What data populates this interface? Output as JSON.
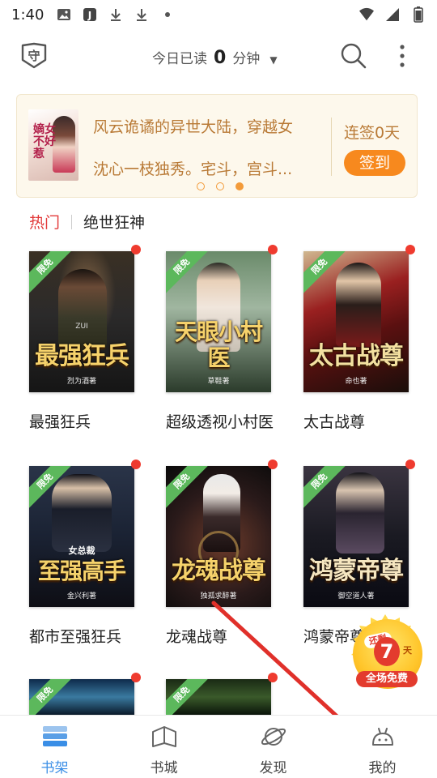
{
  "status_bar": {
    "time": "1:40",
    "left_icons": [
      "image-icon",
      "j-app-icon",
      "download-icon",
      "download-icon",
      "dot-icon"
    ],
    "right_icons": [
      "wifi-icon",
      "signal-icon",
      "battery-icon"
    ]
  },
  "header": {
    "shield_icon": "shield-icon",
    "reading_prefix": "今日已读",
    "reading_minutes": "0",
    "reading_unit": "分钟",
    "dropdown_icon": "triangle-down-icon",
    "search_icon": "search-icon",
    "more_icon": "more-vertical-icon"
  },
  "banner": {
    "cover_text": "嫡女不好惹",
    "line1": "风云诡谲的异世大陆，穿越女",
    "line2": "沈心一枝独秀。宅斗，宫斗...",
    "signin_days": "连签0天",
    "signin_button": "签到",
    "pager_count": 3,
    "pager_active": 2
  },
  "category": {
    "hot": "热门",
    "title": "绝世狂神"
  },
  "badge_label": "限免",
  "books": [
    {
      "title": "最强狂兵",
      "cover_title": "最强狂兵",
      "cover_author": "烈为酒著",
      "cover_zui": "ZUI",
      "colors": [
        "#2b2a2a",
        "#574a3a",
        "#151515"
      ]
    },
    {
      "title": "超级透视小村医",
      "cover_title": "天眼小村医",
      "cover_author": "草鞋著",
      "colors": [
        "#4a6a4a",
        "#a0b6a0",
        "#2b3b2b"
      ]
    },
    {
      "title": "太古战尊",
      "cover_title": "太古战尊",
      "cover_author": "命也著",
      "colors": [
        "#7a1a1a",
        "#c9a37a",
        "#2a1a14"
      ]
    },
    {
      "title": "都市至强狂兵",
      "cover_title": "至强高手",
      "cover_subtitle": "女总裁",
      "cover_author": "金兴利著",
      "colors": [
        "#1a2233",
        "#4a5a7a",
        "#0e0e14"
      ]
    },
    {
      "title": "龙魂战尊",
      "cover_title": "龙魂战尊",
      "cover_author": "独孤求醉著",
      "colors": [
        "#2a1a1a",
        "#6a3a2a",
        "#0a0a0a"
      ]
    },
    {
      "title": "鸿蒙帝尊",
      "cover_title": "鸿蒙帝尊",
      "cover_author": "御空道人著",
      "colors": [
        "#1a1a22",
        "#4a4050",
        "#0a0a12"
      ]
    },
    {
      "title": "",
      "colors": [
        "#0e2a4a",
        "#3a7aa0",
        "#0a1a2a"
      ]
    },
    {
      "title": "",
      "colors": [
        "#1a2a14",
        "#3a5a2a",
        "#0a140a"
      ]
    }
  ],
  "float_badge": {
    "top": "还剩",
    "number": "7",
    "unit": "天",
    "bottom": "全场免费"
  },
  "bottom_nav": [
    {
      "label": "书架",
      "icon": "bookshelf-icon",
      "active": true
    },
    {
      "label": "书城",
      "icon": "book-open-icon",
      "active": false
    },
    {
      "label": "发现",
      "icon": "planet-icon",
      "active": false
    },
    {
      "label": "我的",
      "icon": "mascot-icon",
      "active": false
    }
  ],
  "colors": {
    "accent_orange": "#f7891e",
    "hot_red": "#e23a3a",
    "nav_active": "#3a8ee6",
    "banner_bg": "#fdf8ec",
    "banner_text": "#b97a36",
    "free_badge": "#5cb85c",
    "arrow_red": "#e0302a"
  }
}
